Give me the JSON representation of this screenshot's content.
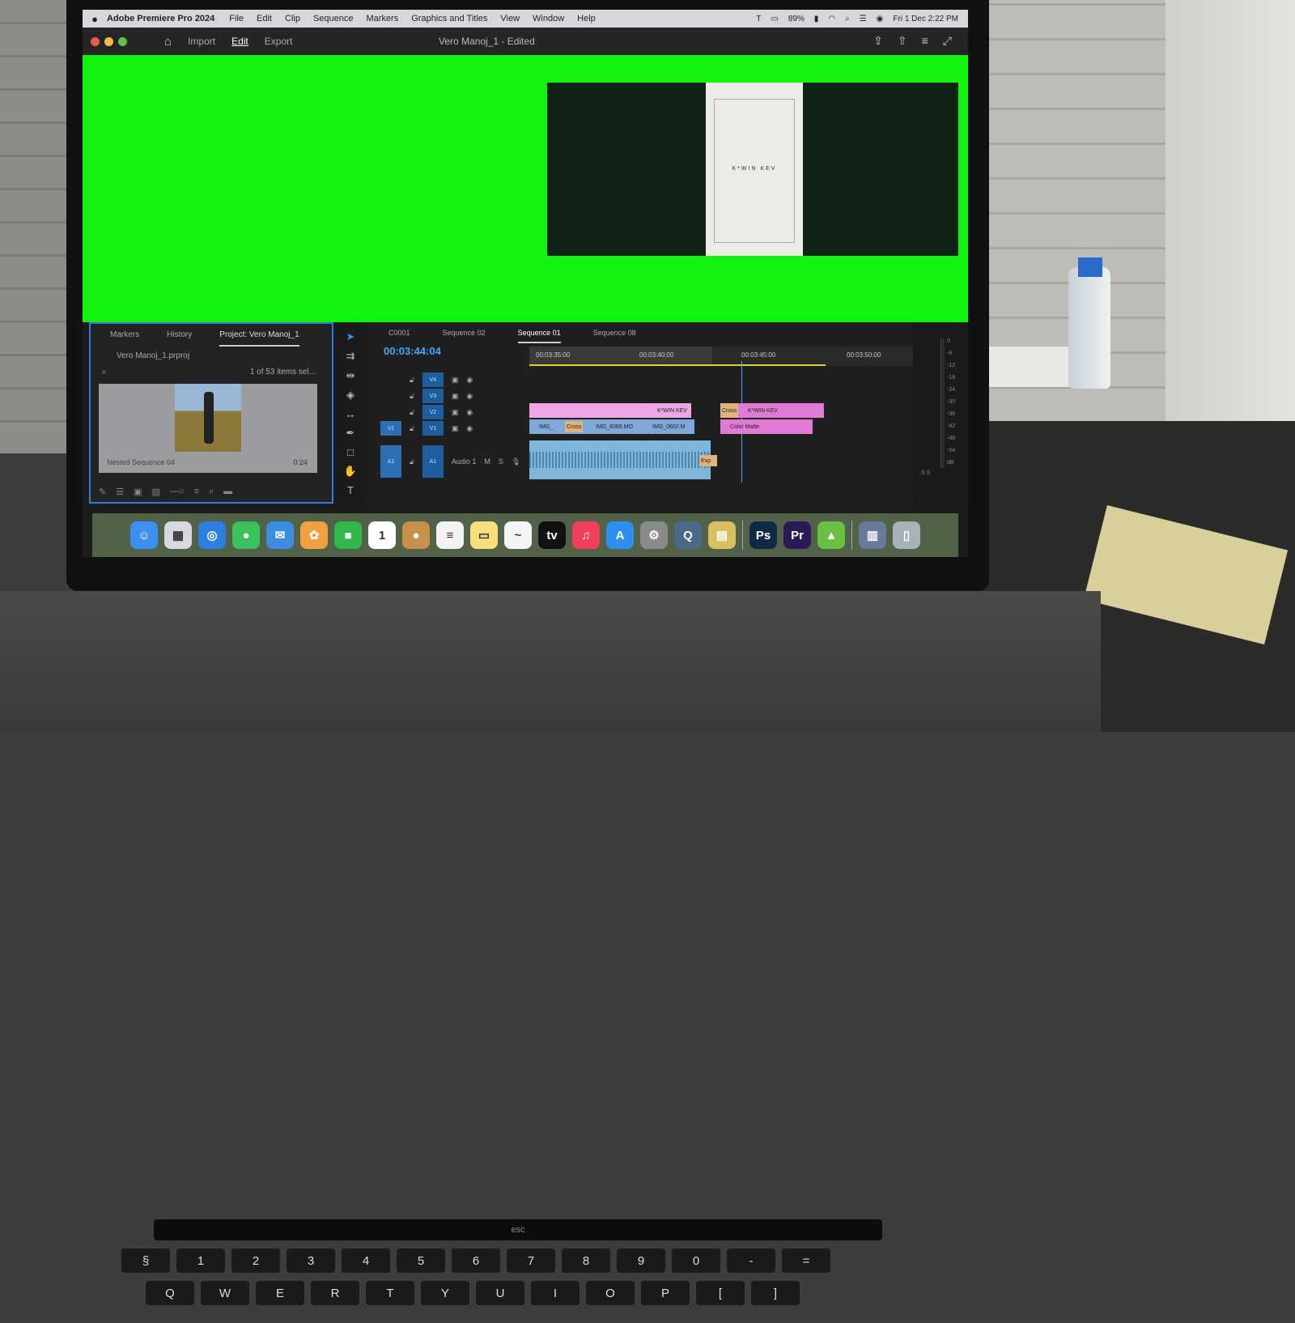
{
  "menubar": {
    "app_name": "Adobe Premiere Pro 2024",
    "items": [
      "File",
      "Edit",
      "Clip",
      "Sequence",
      "Markers",
      "Graphics and Titles",
      "View",
      "Window",
      "Help"
    ],
    "battery": "89%",
    "datetime": "Fri 1 Dec  2:22 PM"
  },
  "toolbar": {
    "import_label": "Import",
    "edit_label": "Edit",
    "export_label": "Export",
    "document_title": "Vero Manoj_1 - Edited"
  },
  "program_monitor": {
    "frame_text": "K*WIN KEV",
    "background_color": "#12f30e"
  },
  "project_panel": {
    "tabs": [
      "Markers",
      "History",
      "Project: Vero Manoj_1"
    ],
    "active_tab": "Project: Vero Manoj_1",
    "file_name": "Vero Manoj_1.prproj",
    "item_count": "1 of 53 items sel...",
    "thumbnail_label": "Nested Sequence 04",
    "thumbnail_duration": "0:24"
  },
  "timeline": {
    "tabs": [
      "C0001",
      "Sequence 02",
      "Sequence 01",
      "Sequence 08"
    ],
    "active_tab": "Sequence 01",
    "timecode": "00:03:44:04",
    "ruler_labels": [
      "00:03:35:00",
      "00:03:40:00",
      "00:03:45:00",
      "00:03:50:00"
    ],
    "tracks": {
      "v4": "V4",
      "v3": "V3",
      "v2": "V2",
      "v1_src": "V1",
      "v1": "V1",
      "a1_src": "A1",
      "a1": "A1",
      "audio_name": "Audio 1",
      "m": "M",
      "s": "S"
    },
    "clips": {
      "v2_clip_1": "K*WIN KEV",
      "v2_clip_2": "K*WIN KEV",
      "v2_cross": "Cross",
      "v1_clip_1": "IMG_",
      "v1_cross": "Cross",
      "v1_clip_2": "IMG_8369.MO",
      "v1_clip_3": "IMG_0602.M",
      "v1_color_matte": "Color Matte",
      "a1_exp": "Exp"
    }
  },
  "meters": {
    "scale": [
      "0",
      "-6",
      "-12",
      "-18",
      "-24",
      "-30",
      "-36",
      "-42",
      "-48",
      "-54",
      "dB"
    ],
    "footer": "S S"
  },
  "dock": {
    "apps": [
      {
        "name": "Finder",
        "icon": "finder-icon",
        "color": "#3b8ff0",
        "glyph": "☺"
      },
      {
        "name": "Launchpad",
        "icon": "launchpad-icon",
        "color": "#d8d8e0",
        "glyph": "▦"
      },
      {
        "name": "Safari",
        "icon": "safari-icon",
        "color": "#2d7fe0",
        "glyph": "◎"
      },
      {
        "name": "Messages",
        "icon": "messages-icon",
        "color": "#38c25a",
        "glyph": "●"
      },
      {
        "name": "Mail",
        "icon": "mail-icon",
        "color": "#3a8de0",
        "glyph": "✉"
      },
      {
        "name": "Photos",
        "icon": "photos-icon",
        "color": "#f0a040",
        "glyph": "✿"
      },
      {
        "name": "FaceTime",
        "icon": "facetime-icon",
        "color": "#30b848",
        "glyph": "■"
      },
      {
        "name": "Calendar",
        "icon": "calendar-icon",
        "color": "#ffffff",
        "glyph": "1"
      },
      {
        "name": "Contacts",
        "icon": "contacts-icon",
        "color": "#c8904a",
        "glyph": "●"
      },
      {
        "name": "Reminders",
        "icon": "reminders-icon",
        "color": "#f2f2f2",
        "glyph": "≡"
      },
      {
        "name": "Notes",
        "icon": "notes-icon",
        "color": "#f6e07a",
        "glyph": "▭"
      },
      {
        "name": "Freeform",
        "icon": "freeform-icon",
        "color": "#f4f4f4",
        "glyph": "~"
      },
      {
        "name": "TV",
        "icon": "appletv-icon",
        "color": "#111111",
        "glyph": "tv"
      },
      {
        "name": "Music",
        "icon": "music-icon",
        "color": "#f0405a",
        "glyph": "♫"
      },
      {
        "name": "App Store",
        "icon": "appstore-icon",
        "color": "#2f8ef2",
        "glyph": "A"
      },
      {
        "name": "System Settings",
        "icon": "settings-icon",
        "color": "#8a8a8a",
        "glyph": "⚙"
      },
      {
        "name": "QuickTime",
        "icon": "quicktime-icon",
        "color": "#4a6a8a",
        "glyph": "Q"
      },
      {
        "name": "Preview",
        "icon": "preview-icon",
        "color": "#d8c060",
        "glyph": "▤"
      },
      {
        "name": "Photoshop",
        "icon": "photoshop-icon",
        "color": "#0f2a44",
        "glyph": "Ps"
      },
      {
        "name": "Premiere Pro",
        "icon": "premiere-icon",
        "color": "#2a1a55",
        "glyph": "Pr"
      },
      {
        "name": "Android File Transfer",
        "icon": "android-icon",
        "color": "#6ac040",
        "glyph": "▲"
      },
      {
        "name": "Downloads",
        "icon": "downloads-icon",
        "color": "#6a7a9a",
        "glyph": "▥"
      },
      {
        "name": "Trash",
        "icon": "trash-icon",
        "color": "#a8b0b8",
        "glyph": "▯"
      }
    ]
  },
  "keyboard": {
    "row_numbers": [
      "§",
      "1",
      "2",
      "3",
      "4",
      "5",
      "6",
      "7",
      "8",
      "9",
      "0",
      "-",
      "="
    ],
    "row_letters": [
      "Q",
      "W",
      "E",
      "R",
      "T",
      "Y",
      "U",
      "I",
      "O",
      "P",
      "[",
      "]"
    ],
    "esc_label": "esc"
  }
}
